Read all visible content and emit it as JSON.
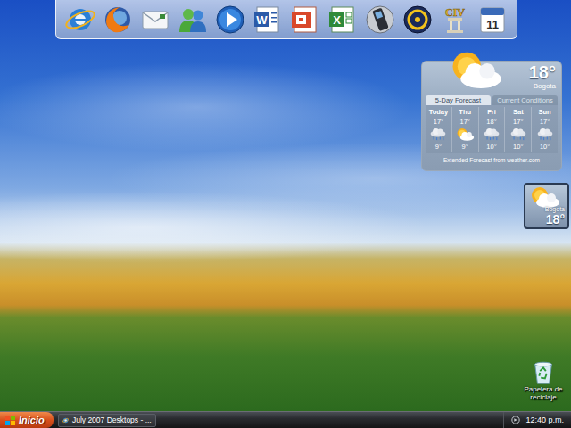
{
  "dock": {
    "items": [
      {
        "kind": "ie"
      },
      {
        "kind": "firefox"
      },
      {
        "kind": "mail"
      },
      {
        "kind": "messenger"
      },
      {
        "kind": "media-player"
      },
      {
        "kind": "word",
        "text": "W"
      },
      {
        "kind": "powerpoint"
      },
      {
        "kind": "excel",
        "text": "X"
      },
      {
        "kind": "phone"
      },
      {
        "kind": "power-dvd"
      },
      {
        "kind": "civ",
        "text": "CIV"
      },
      {
        "kind": "calendar",
        "text": "11"
      }
    ]
  },
  "weather": {
    "temp": "18°",
    "city": "Bogota",
    "kind": "sun-cloud",
    "tabs": [
      {
        "label": "5-Day Forecast",
        "selected": true
      },
      {
        "label": "Current Conditions",
        "selected": false
      }
    ],
    "days": [
      {
        "day": "Today",
        "high": "17°",
        "low": "9°",
        "kind": "rain"
      },
      {
        "day": "Thu",
        "high": "17°",
        "low": "9°",
        "kind": "sun-cloud"
      },
      {
        "day": "Fri",
        "high": "18°",
        "low": "10°",
        "kind": "rain"
      },
      {
        "day": "Sat",
        "high": "17°",
        "low": "10°",
        "kind": "rain"
      },
      {
        "day": "Sun",
        "high": "17°",
        "low": "10°",
        "kind": "rain"
      }
    ],
    "footer": "Extended Forecast from weather.com"
  },
  "mini_weather": {
    "city": "Bogota",
    "temp": "18°",
    "kind": "sun-cloud"
  },
  "desktop_icons": [
    {
      "label": "Papelera de reciclaje",
      "kind": "recycle-bin"
    }
  ],
  "taskbar": {
    "start": "Inicio",
    "tasks": [
      {
        "label": "July 2007 Desktops - ...",
        "selected": false
      }
    ],
    "clock": "12:40 p.m."
  }
}
